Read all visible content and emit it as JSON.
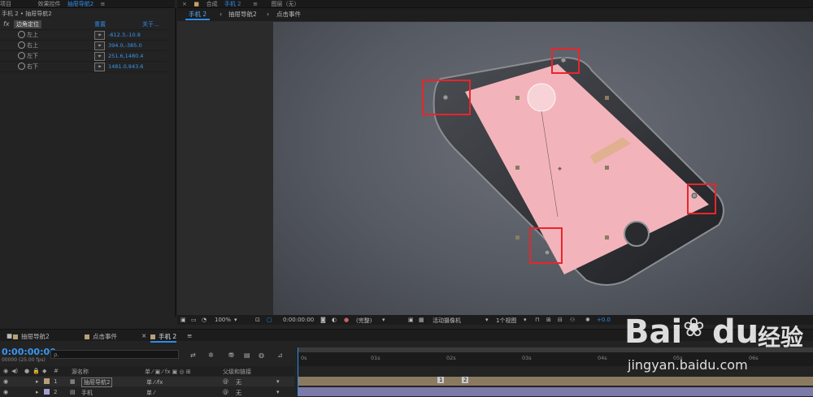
{
  "top_tabs": {
    "project": "项目",
    "effect_controls_prefix": "效果控件",
    "effect_controls_target": "抽屉导航2",
    "composition_prefix": "合成",
    "composition_target": "手机 2",
    "layer": "图层（无）"
  },
  "effect_controls": {
    "breadcrumb": "手机 2 • 抽屉导航2",
    "effect": {
      "fx": "fx",
      "name": "边角定位",
      "reset": "重置",
      "about": "关于..."
    },
    "params": [
      {
        "label": "左上",
        "value": "-612.3,-10.8"
      },
      {
        "label": "右上",
        "value": "394.0,-385.0"
      },
      {
        "label": "左下",
        "value": "251.6,1480.4"
      },
      {
        "label": "右下",
        "value": "1481.0,943.6"
      }
    ]
  },
  "composition": {
    "breadcrumbs": [
      "手机 2",
      "抽屉导航2",
      "点击事件"
    ],
    "toolbar": {
      "zoom": "100%",
      "timecode": "0:00:00:00",
      "resolution": "(完整)",
      "camera": "活动摄像机",
      "views": "1个视图",
      "exposure": "+0.0"
    }
  },
  "timeline": {
    "tabs": [
      "抽屉导航2",
      "点击事件",
      "手机 2"
    ],
    "active_tab_index": 2,
    "timecode": "0:00:00:00",
    "fps": "00000 (25.00 fps)",
    "search_placeholder": "ρ.",
    "columns": {
      "number": "#",
      "source_name": "源名称",
      "parent": "父级和链接"
    },
    "layers": [
      {
        "index": "1",
        "name": "抽屉导航2",
        "parent": "无"
      },
      {
        "index": "2",
        "name": "手机",
        "parent": "无"
      }
    ],
    "ruler_labels": [
      "0s",
      "01s",
      "02s",
      "03s",
      "04s",
      "05s",
      "06s"
    ],
    "markers": [
      "1",
      "2"
    ]
  },
  "watermark": {
    "brand": "Bai",
    "brand2": "du",
    "chinese": "经验",
    "url": "jingyan.baidu.com"
  },
  "colors": {
    "accent": "#2d8ceb",
    "screen_pink": "#f2b4ba",
    "highlight_red": "#e8252c",
    "layer_bar": "#8a7b60"
  }
}
